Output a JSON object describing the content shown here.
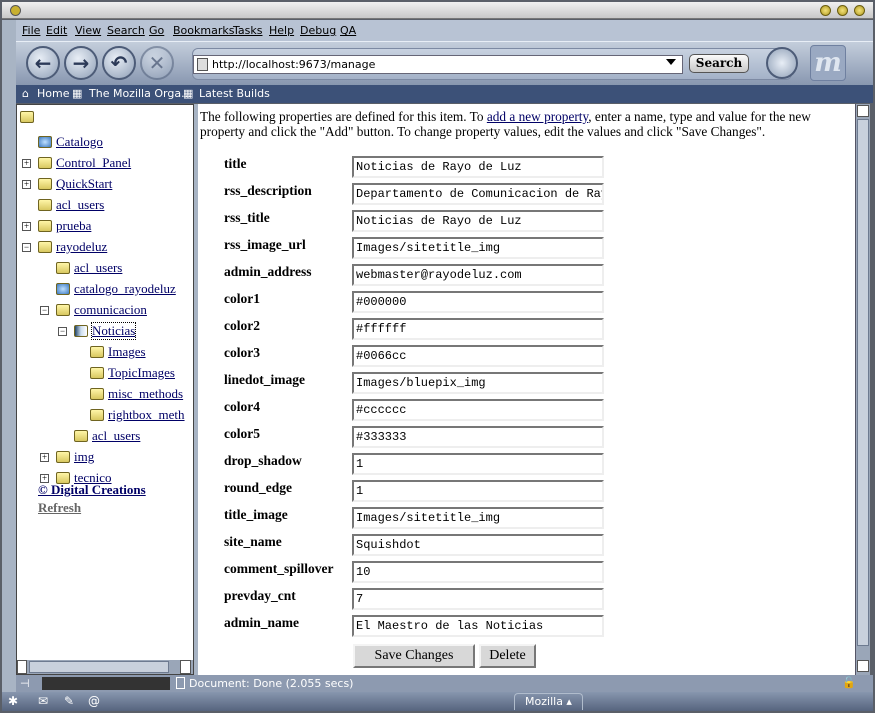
{
  "menu": [
    "File",
    "Edit",
    "View",
    "Search",
    "Go",
    "Bookmarks",
    "Tasks",
    "Help",
    "Debug",
    "QA"
  ],
  "url": "http://localhost:9673/manage",
  "search_label": "Search",
  "bookmarks": [
    "Home",
    "The Mozilla Orga...",
    "Latest Builds"
  ],
  "tree": [
    {
      "label": "",
      "icon": "folder",
      "level": 0
    },
    {
      "label": "Catalogo",
      "icon": "catalog",
      "level": 1
    },
    {
      "label": "Control_Panel",
      "icon": "control-panel",
      "level": 1,
      "expander": "+"
    },
    {
      "label": "QuickStart",
      "icon": "folder",
      "level": 1,
      "expander": "+"
    },
    {
      "label": "acl_users",
      "icon": "user-folder",
      "level": 1
    },
    {
      "label": "prueba",
      "icon": "folder",
      "level": 1,
      "expander": "+"
    },
    {
      "label": "rayodeluz",
      "icon": "folder",
      "level": 1,
      "expander": "-"
    },
    {
      "label": "acl_users",
      "icon": "user-folder",
      "level": 2
    },
    {
      "label": "catalogo_rayodeluz",
      "icon": "catalog",
      "level": 2
    },
    {
      "label": "comunicacion",
      "icon": "folder",
      "level": 2,
      "expander": "-"
    },
    {
      "label": "Noticias",
      "icon": "squishsite",
      "level": 3,
      "expander": "-"
    },
    {
      "label": "Images",
      "icon": "folder",
      "level": 4
    },
    {
      "label": "TopicImages",
      "icon": "folder",
      "level": 4
    },
    {
      "label": "misc_methods",
      "icon": "folder",
      "level": 4
    },
    {
      "label": "rightbox_meth",
      "icon": "folder",
      "level": 4
    },
    {
      "label": "acl_users",
      "icon": "user-folder",
      "level": 3
    },
    {
      "label": "img",
      "icon": "folder",
      "level": 2,
      "expander": "+"
    },
    {
      "label": "tecnico",
      "icon": "folder",
      "level": 2,
      "expander": "+"
    }
  ],
  "tree_footer": {
    "copyright": "© Digital Creations",
    "refresh": "Refresh"
  },
  "intro": {
    "before": "The following properties are defined for this item. To ",
    "link": "add a new property",
    "after": ", enter a name, type and value for the new property and click the \"Add\" button. To change property values, edit the values and click \"Save Changes\"."
  },
  "properties": [
    {
      "name": "title",
      "value": "Noticias de Rayo de Luz"
    },
    {
      "name": "rss_description",
      "value": "Departamento de Comunicacion de Rayo"
    },
    {
      "name": "rss_title",
      "value": "Noticias de Rayo de Luz"
    },
    {
      "name": "rss_image_url",
      "value": "Images/sitetitle_img"
    },
    {
      "name": "admin_address",
      "value": "webmaster@rayodeluz.com"
    },
    {
      "name": "color1",
      "value": "#000000"
    },
    {
      "name": "color2",
      "value": "#ffffff"
    },
    {
      "name": "color3",
      "value": "#0066cc"
    },
    {
      "name": "linedot_image",
      "value": "Images/bluepix_img"
    },
    {
      "name": "color4",
      "value": "#cccccc"
    },
    {
      "name": "color5",
      "value": "#333333"
    },
    {
      "name": "drop_shadow",
      "value": "1"
    },
    {
      "name": "round_edge",
      "value": "1"
    },
    {
      "name": "title_image",
      "value": "Images/sitetitle_img"
    },
    {
      "name": "site_name",
      "value": "Squishdot"
    },
    {
      "name": "comment_spillover",
      "value": "10"
    },
    {
      "name": "prevday_cnt",
      "value": "7"
    },
    {
      "name": "admin_name",
      "value": "El Maestro de las Noticias"
    }
  ],
  "buttons": {
    "save": "Save Changes",
    "delete": "Delete"
  },
  "status": "Document: Done (2.055 secs)",
  "taskbar_label": "Mozilla ▴"
}
